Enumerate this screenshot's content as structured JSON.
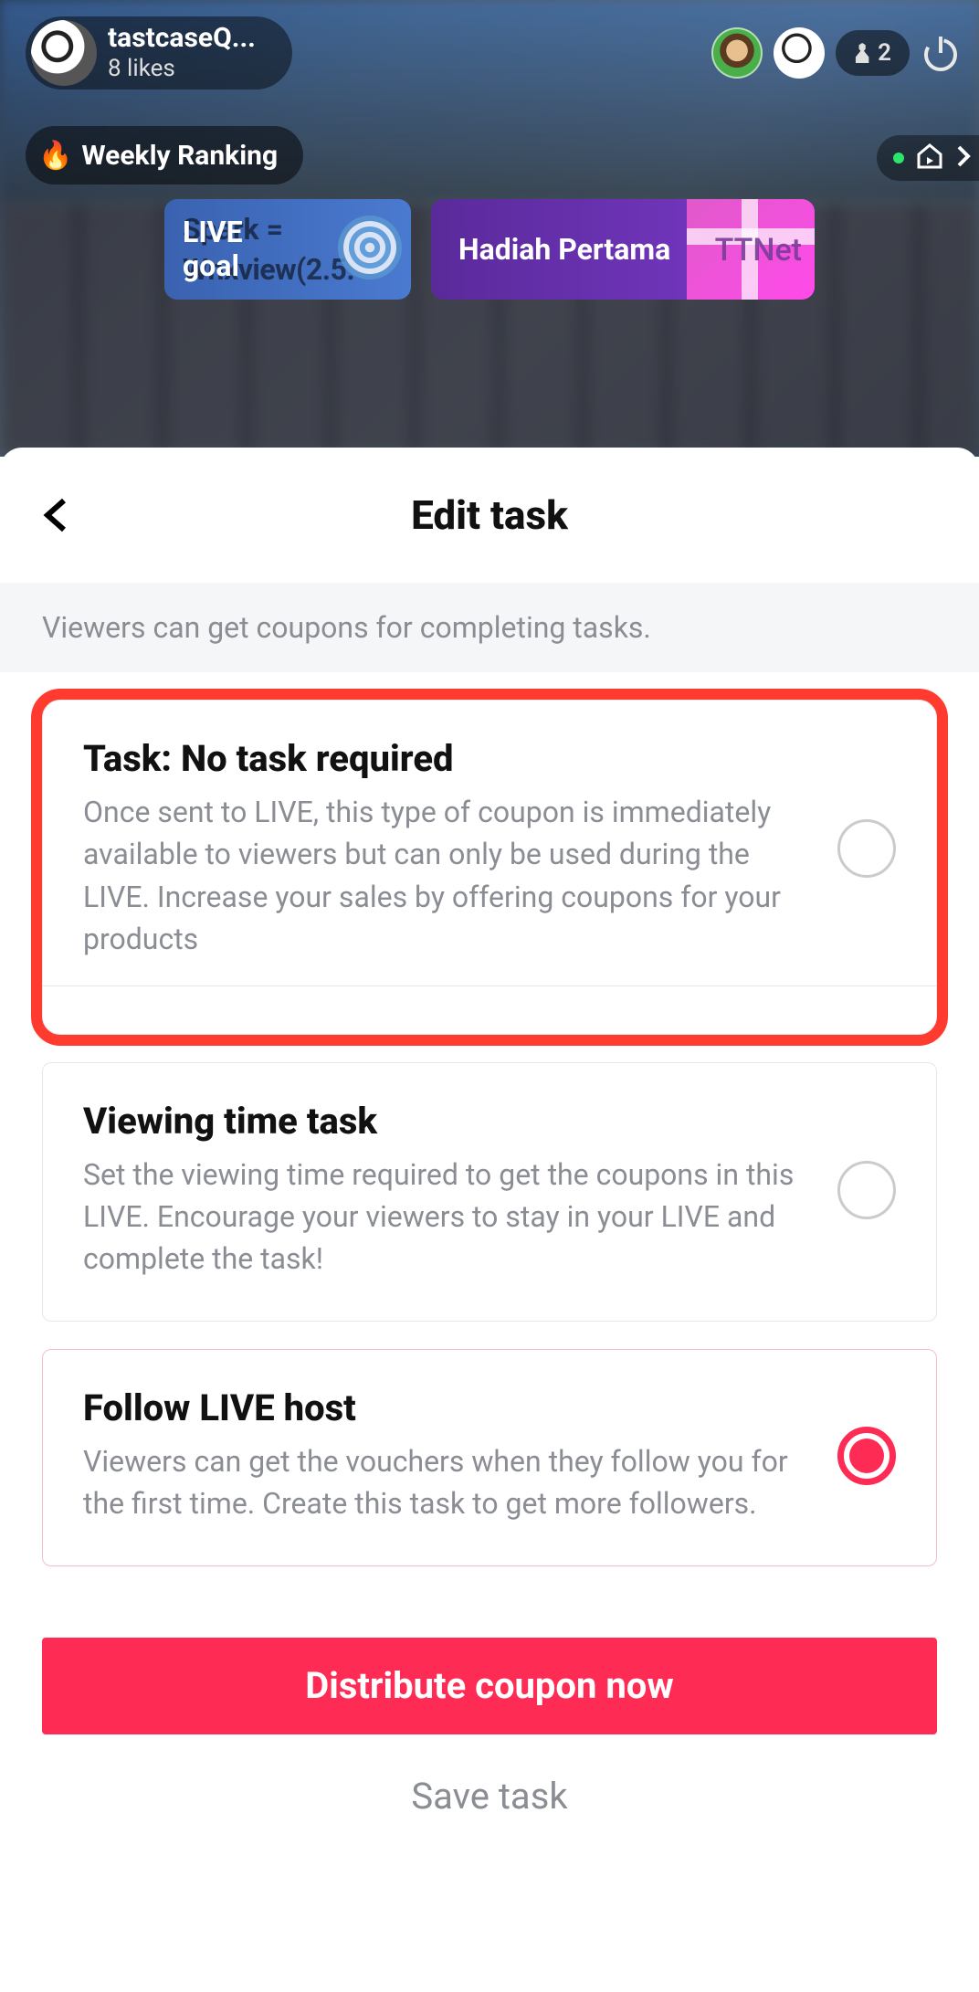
{
  "header": {
    "username": "tastcaseQ...",
    "likes": "8 likes",
    "viewer_count": "2",
    "weekly_ranking": "Weekly Ranking"
  },
  "badges": {
    "live_goal_line1": "LIVE",
    "live_goal_line2": "goal",
    "overlay_line1": "Spark =",
    "overlay_line2": "Wnxview(2.5.",
    "hadiah": "Hadiah Pertama",
    "ttnet": "TTNet"
  },
  "sheet": {
    "title": "Edit task",
    "notice": "Viewers can get coupons for completing tasks.",
    "options": [
      {
        "title": "Task: No task required",
        "desc": "Once sent to LIVE, this type of coupon is immediately available to viewers but can only be used during the LIVE. Increase your sales by offering coupons for your products",
        "selected": false,
        "highlighted": true
      },
      {
        "title": "Viewing time task",
        "desc": "Set the viewing time required to get the coupons in this LIVE. Encourage your viewers to stay in your LIVE and complete the task!",
        "selected": false,
        "highlighted": false
      },
      {
        "title": "Follow LIVE host",
        "desc": "Viewers can get the vouchers when they follow you for the first time. Create this task to get more followers.",
        "selected": true,
        "highlighted": false
      }
    ],
    "distribute_label": "Distribute coupon now",
    "save_label": "Save task"
  }
}
